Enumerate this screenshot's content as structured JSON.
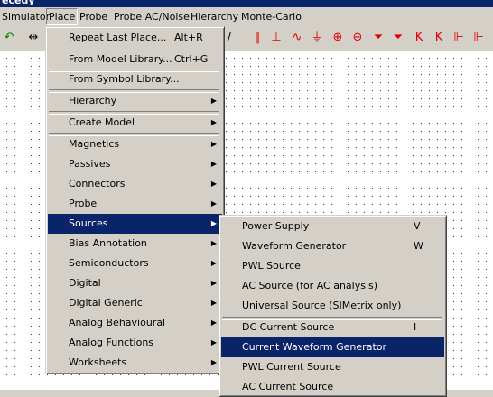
{
  "window": {
    "title_fragment": "ecedy"
  },
  "menubar": [
    {
      "label": "Simulator"
    },
    {
      "label": "Place"
    },
    {
      "label": "Probe"
    },
    {
      "label": "Probe AC/Noise"
    },
    {
      "label": "Hierarchy"
    },
    {
      "label": "Monte-Carlo"
    }
  ],
  "toolbar_icons": [
    "undo-arrow-icon",
    "mirror-icon",
    "pin-icon",
    "capacitor-icon",
    "inductor-icon",
    "ground-icon",
    "current-source-icon",
    "voltage-source-icon",
    "diode-icon",
    "zener-diode-icon",
    "transistor-npn-icon",
    "transistor-pnp-icon",
    "jfet-icon",
    "mosfet-icon"
  ],
  "place_menu": [
    {
      "label": "Repeat Last Place...",
      "shortcut": "Alt+R"
    },
    {
      "label": "From Model Library...",
      "shortcut": "Ctrl+G"
    },
    {
      "label": "From Symbol Library..."
    },
    {
      "label": "Hierarchy",
      "submenu": true
    },
    {
      "label": "Create Model",
      "submenu": true
    },
    {
      "label": "Magnetics",
      "submenu": true
    },
    {
      "label": "Passives",
      "submenu": true
    },
    {
      "label": "Connectors",
      "submenu": true
    },
    {
      "label": "Probe",
      "submenu": true
    },
    {
      "label": "Sources",
      "submenu": true,
      "selected": true
    },
    {
      "label": "Bias Annotation",
      "submenu": true
    },
    {
      "label": "Semiconductors",
      "submenu": true
    },
    {
      "label": "Digital",
      "submenu": true
    },
    {
      "label": "Digital Generic",
      "submenu": true
    },
    {
      "label": "Analog Behavioural",
      "submenu": true
    },
    {
      "label": "Analog Functions",
      "submenu": true
    },
    {
      "label": "Worksheets",
      "submenu": true
    }
  ],
  "sources_menu": [
    {
      "label": "Power Supply",
      "shortcut": "V"
    },
    {
      "label": "Waveform Generator",
      "shortcut": "W"
    },
    {
      "label": "PWL Source"
    },
    {
      "label": "AC Source (for AC analysis)"
    },
    {
      "label": "Universal Source (SIMetrix only)"
    },
    {
      "label": "DC Current Source",
      "shortcut": "I"
    },
    {
      "label": "Current Waveform Generator",
      "selected": true
    },
    {
      "label": "PWL Current Source"
    },
    {
      "label": "AC Current Source"
    }
  ]
}
